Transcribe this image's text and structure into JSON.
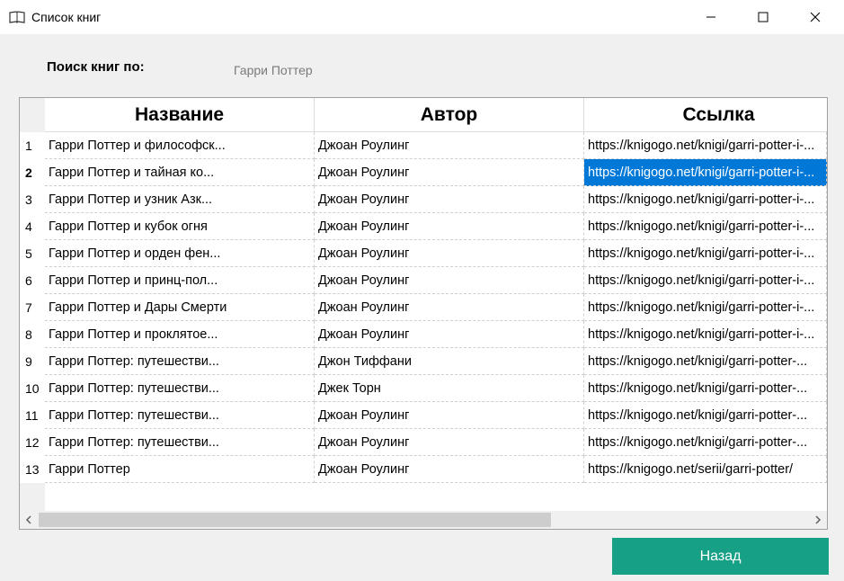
{
  "window": {
    "title": "Список книг",
    "icon": "book-icon"
  },
  "search": {
    "label": "Поиск книг по:",
    "value": "Гарри Поттер"
  },
  "table": {
    "columns": [
      "Название",
      "Автор",
      "Ссылка"
    ],
    "selected_row": 2,
    "rows": [
      {
        "num": "1",
        "title": "Гарри Поттер и философск...",
        "author": "Джоан Роулинг",
        "link": "https://knigogo.net/knigi/garri-potter-i-..."
      },
      {
        "num": "2",
        "title": "Гарри Поттер и тайная ко...",
        "author": "Джоан Роулинг",
        "link": "https://knigogo.net/knigi/garri-potter-i-..."
      },
      {
        "num": "3",
        "title": "Гарри Поттер и узник Азк...",
        "author": "Джоан Роулинг",
        "link": "https://knigogo.net/knigi/garri-potter-i-..."
      },
      {
        "num": "4",
        "title": "Гарри Поттер и кубок огня",
        "author": "Джоан Роулинг",
        "link": "https://knigogo.net/knigi/garri-potter-i-..."
      },
      {
        "num": "5",
        "title": "Гарри Поттер и орден фен...",
        "author": "Джоан Роулинг",
        "link": "https://knigogo.net/knigi/garri-potter-i-..."
      },
      {
        "num": "6",
        "title": "Гарри Поттер и принц-пол...",
        "author": "Джоан Роулинг",
        "link": "https://knigogo.net/knigi/garri-potter-i-..."
      },
      {
        "num": "7",
        "title": "Гарри Поттер и Дары Смерти",
        "author": "Джоан Роулинг",
        "link": "https://knigogo.net/knigi/garri-potter-i-..."
      },
      {
        "num": "8",
        "title": "Гарри Поттер и проклятое...",
        "author": "Джоан Роулинг",
        "link": "https://knigogo.net/knigi/garri-potter-i-..."
      },
      {
        "num": "9",
        "title": "Гарри Поттер: путешестви...",
        "author": "Джон Тиффани",
        "link": "https://knigogo.net/knigi/garri-potter-..."
      },
      {
        "num": "10",
        "title": "Гарри Поттер: путешестви...",
        "author": "Джек Торн",
        "link": "https://knigogo.net/knigi/garri-potter-..."
      },
      {
        "num": "11",
        "title": "Гарри Поттер: путешестви...",
        "author": "Джоан Роулинг",
        "link": "https://knigogo.net/knigi/garri-potter-..."
      },
      {
        "num": "12",
        "title": "Гарри Поттер: путешестви...",
        "author": "Джоан Роулинг",
        "link": "https://knigogo.net/knigi/garri-potter-..."
      },
      {
        "num": "13",
        "title": "Гарри Поттер",
        "author": "Джоан Роулинг",
        "link": "https://knigogo.net/serii/garri-potter/"
      }
    ]
  },
  "buttons": {
    "back": "Назад"
  },
  "colors": {
    "accent": "#16a085",
    "selection": "#0078d7"
  }
}
